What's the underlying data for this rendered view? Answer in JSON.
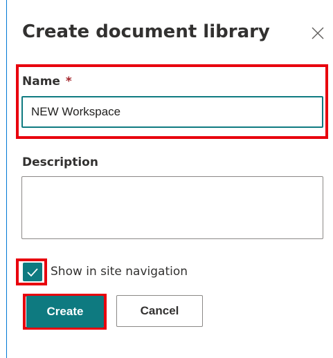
{
  "panel": {
    "title": "Create document library"
  },
  "form": {
    "name_label": "Name",
    "required_marker": "*",
    "name_value": "NEW Workspace",
    "description_label": "Description",
    "description_value": "",
    "show_in_nav_label": "Show in site navigation",
    "show_in_nav_checked": true
  },
  "buttons": {
    "create_label": "Create",
    "cancel_label": "Cancel"
  },
  "icons": {
    "close": "close-icon",
    "check": "checkmark-icon"
  },
  "colors": {
    "accent": "#0e7a80",
    "highlight": "#e8000d",
    "required": "#a4262c"
  }
}
